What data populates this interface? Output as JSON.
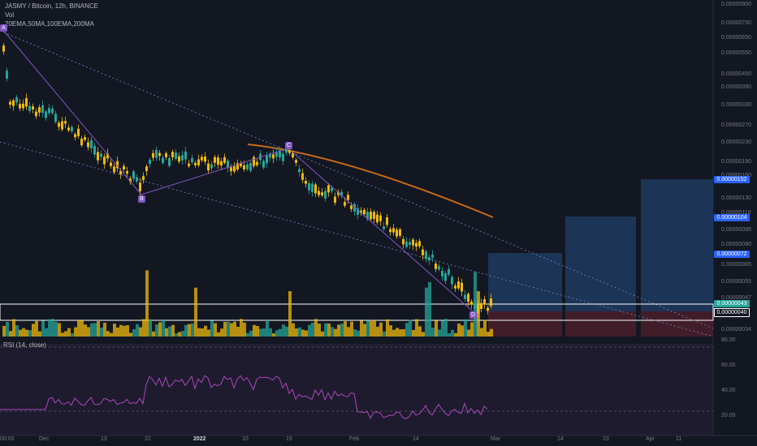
{
  "header": {
    "title": "JASMY / Bitcoin, 12h, BINANCE",
    "vol_label": "Vol",
    "indicators": "20EMA,50MA,100EMA,200MA",
    "rsi_label": "RSI (14, close)"
  },
  "colors": {
    "background": "#131722",
    "up": "#26a69a",
    "down": "#f0b90b",
    "pattern": "#7e57c2",
    "ema": "#c76a1a",
    "channel": "#7983c8",
    "target_box": "#1e3a5f",
    "stop_box": "#4a1f2a",
    "rsi_line": "#ab47bc",
    "tag_blue": "#2962ff"
  },
  "price_axis": {
    "labels": [
      "0.00000900",
      "0.00000750",
      "0.00000650",
      "0.00000550",
      "0.00000450",
      "0.00000390",
      "0.00000330",
      "0.00000270",
      "0.00000230",
      "0.00000190",
      "0.00000160",
      "0.00000130",
      "0.00000110",
      "0.00000095",
      "0.00000080",
      "0.00000065",
      "0.00000055",
      "0.00000047",
      "0.00000034"
    ],
    "tags": [
      {
        "value": "0.00000152"
      },
      {
        "value": "0.00000104"
      },
      {
        "value": "0.00000072"
      },
      {
        "value": "0.00000043"
      },
      {
        "value": "0.00000040"
      }
    ]
  },
  "time_axis": {
    "labels": [
      "00:00",
      "Dec",
      "13",
      "22",
      "2022",
      "10",
      "19",
      "Feb",
      "14",
      "Mar",
      "14",
      "23",
      "Apr",
      "11"
    ]
  },
  "rsi_axis": {
    "labels": [
      "80.00",
      "60.00",
      "40.00",
      "20.00"
    ]
  },
  "pattern_points": [
    "A",
    "B",
    "C",
    "D"
  ],
  "chart_data": {
    "type": "candlestick",
    "symbol": "JASMY / Bitcoin",
    "interval": "12h",
    "exchange": "BINANCE",
    "scale": "log",
    "xabc_points": [
      {
        "label": "A",
        "time": "late Nov 2021",
        "price": 6.8e-06
      },
      {
        "label": "B",
        "time": "Dec 21 2021",
        "price": 1.4e-06
      },
      {
        "label": "C",
        "time": "Jan 19 2022",
        "price": 2.1e-06
      },
      {
        "label": "D",
        "time": "Feb 26 2022",
        "price": 4e-07
      }
    ],
    "targets": [
      7.2e-07,
      1.04e-06,
      1.52e-06
    ],
    "entry_zone": [
      4e-07,
      4.3e-07
    ],
    "rsi": {
      "period": 14,
      "source": "close",
      "levels": [
        80,
        20
      ]
    }
  }
}
